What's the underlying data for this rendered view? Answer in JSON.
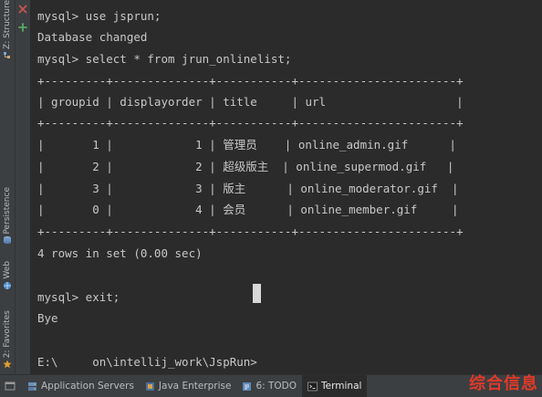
{
  "left_strip": {
    "structure_label": "Z: Structure",
    "persistence_label": "Persistence",
    "web_label": "Web",
    "favorites_label": "2: Favorites"
  },
  "terminal": {
    "lines": [
      "mysql> use jsprun;",
      "Database changed",
      "mysql> select * from jrun_onlinelist;",
      "+---------+--------------+-----------+-----------------------+",
      "| groupid | displayorder | title     | url                   |",
      "+---------+--------------+-----------+-----------------------+",
      "|       1 |            1 | 管理员    | online_admin.gif      |",
      "|       2 |            2 | 超级版主  | online_supermod.gif   |",
      "|       3 |            3 | 版主      | online_moderator.gif  |",
      "|       0 |            4 | 会员      | online_member.gif     |",
      "+---------+--------------+-----------+-----------------------+",
      "4 rows in set (0.00 sec)",
      "",
      "mysql> exit;",
      "Bye",
      "",
      "E:\\     on\\intellij_work\\JspRun>"
    ]
  },
  "bottom_tabs": [
    {
      "label": "Application Servers",
      "icon": "server-icon",
      "active": false
    },
    {
      "label": "Java Enterprise",
      "icon": "java-ee-icon",
      "active": false
    },
    {
      "label": "6: TODO",
      "icon": "todo-icon",
      "active": false
    },
    {
      "label": "Terminal",
      "icon": "terminal-icon",
      "active": true
    }
  ],
  "watermark": "综合信息",
  "colors": {
    "background": "#2b2b2b",
    "panel": "#3c3f41",
    "text": "#c8c8c8",
    "close_red": "#c75450",
    "watermark_red": "#e03a2a"
  }
}
